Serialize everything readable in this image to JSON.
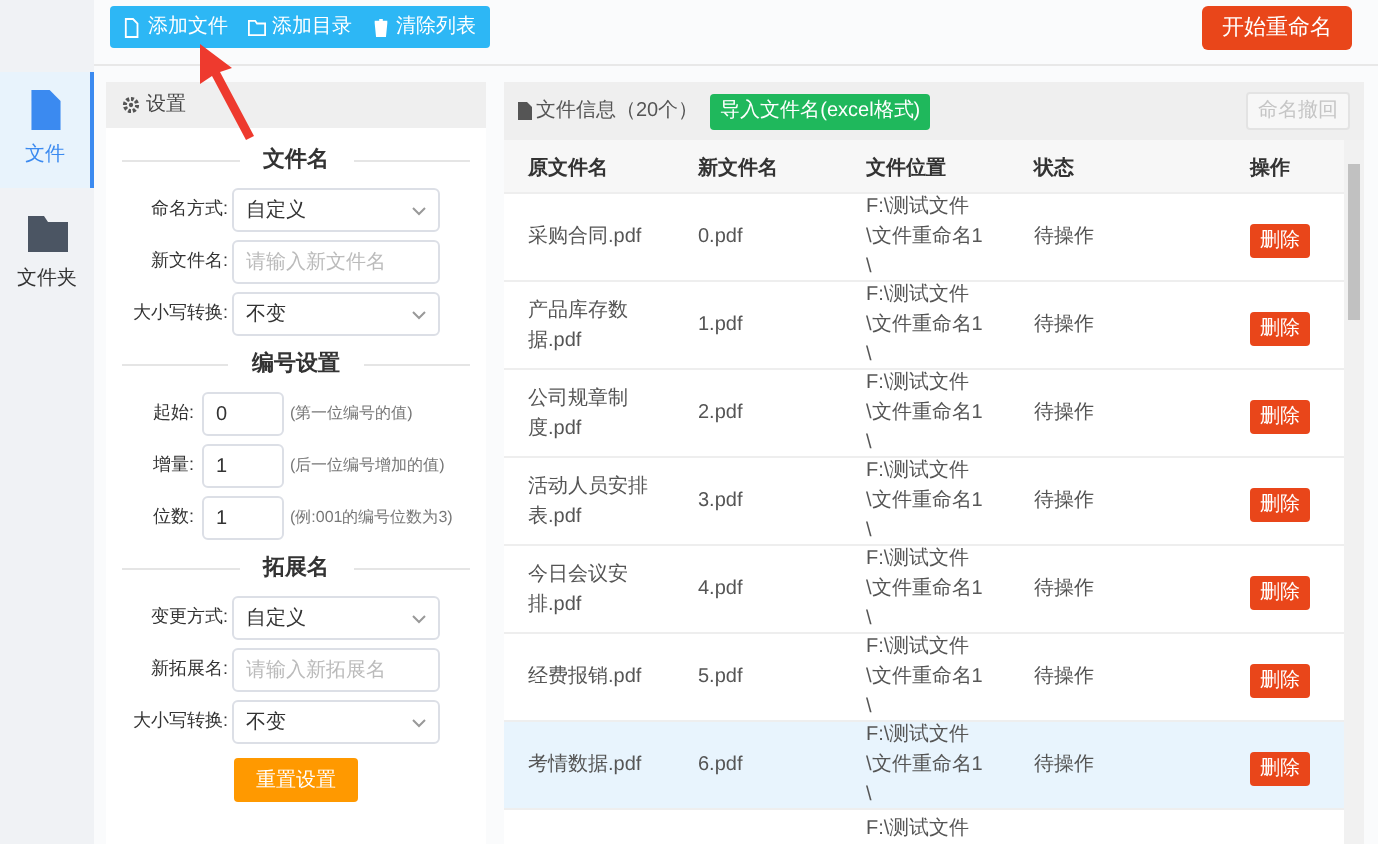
{
  "sidebar": {
    "items": [
      {
        "kind": "file",
        "label": "文件",
        "selected": true
      },
      {
        "kind": "folder",
        "label": "文件夹",
        "selected": false
      }
    ]
  },
  "toolbar": {
    "buttons": [
      {
        "kind": "file",
        "label": "添加文件"
      },
      {
        "kind": "folder",
        "label": "添加目录"
      },
      {
        "kind": "trash",
        "label": "清除列表"
      }
    ],
    "start_button": "开始重命名"
  },
  "settings": {
    "title": "设置",
    "sections": [
      {
        "title": "文件名",
        "fields": [
          {
            "kind": "select",
            "label": "命名方式:",
            "value": "自定义"
          },
          {
            "kind": "input",
            "label": "新文件名:",
            "placeholder": "请输入新文件名"
          },
          {
            "kind": "select",
            "label": "大小写转换:",
            "value": "不变"
          }
        ]
      },
      {
        "title": "编号设置",
        "fields": [
          {
            "kind": "number",
            "label": "起始:",
            "value": "0",
            "hint": "(第一位编号的值)"
          },
          {
            "kind": "number",
            "label": "增量:",
            "value": "1",
            "hint": "(后一位编号增加的值)"
          },
          {
            "kind": "number",
            "label": "位数:",
            "value": "1",
            "hint": "(例:001的编号位数为3)"
          }
        ]
      },
      {
        "title": "拓展名",
        "fields": [
          {
            "kind": "select",
            "label": "变更方式:",
            "value": "自定义"
          },
          {
            "kind": "input",
            "label": "新拓展名:",
            "placeholder": "请输入新拓展名"
          },
          {
            "kind": "select",
            "label": "大小写转换:",
            "value": "不变"
          }
        ]
      }
    ],
    "reset_button": "重置设置"
  },
  "files": {
    "title": "文件信息（20个）",
    "import_button": "导入文件名(excel格式)",
    "undo_button": {
      "label": "命名撤回",
      "disabled": true
    },
    "columns": [
      "原文件名",
      "新文件名",
      "文件位置",
      "状态",
      "操作"
    ],
    "rows": [
      {
        "original": "采购合同.pdf",
        "new": "0.pdf",
        "location": "F:\\测试文件\\文件重命名1\\",
        "status": "待操作",
        "action": "删除",
        "selected": false
      },
      {
        "original": "产品库存数据.pdf",
        "new": "1.pdf",
        "location": "F:\\测试文件\\文件重命名1\\",
        "status": "待操作",
        "action": "删除",
        "selected": false
      },
      {
        "original": "公司规章制度.pdf",
        "new": "2.pdf",
        "location": "F:\\测试文件\\文件重命名1\\",
        "status": "待操作",
        "action": "删除",
        "selected": false
      },
      {
        "original": "活动人员安排表.pdf",
        "new": "3.pdf",
        "location": "F:\\测试文件\\文件重命名1\\",
        "status": "待操作",
        "action": "删除",
        "selected": false
      },
      {
        "original": "今日会议安排.pdf",
        "new": "4.pdf",
        "location": "F:\\测试文件\\文件重命名1\\",
        "status": "待操作",
        "action": "删除",
        "selected": false
      },
      {
        "original": "经费报销.pdf",
        "new": "5.pdf",
        "location": "F:\\测试文件\\文件重命名1\\",
        "status": "待操作",
        "action": "删除",
        "selected": false
      },
      {
        "original": "考情数据.pdf",
        "new": "6.pdf",
        "location": "F:\\测试文件\\文件重命名1\\",
        "status": "待操作",
        "action": "删除",
        "selected": true
      },
      {
        "location": "F:\\测试文件",
        "selected": false
      }
    ]
  }
}
